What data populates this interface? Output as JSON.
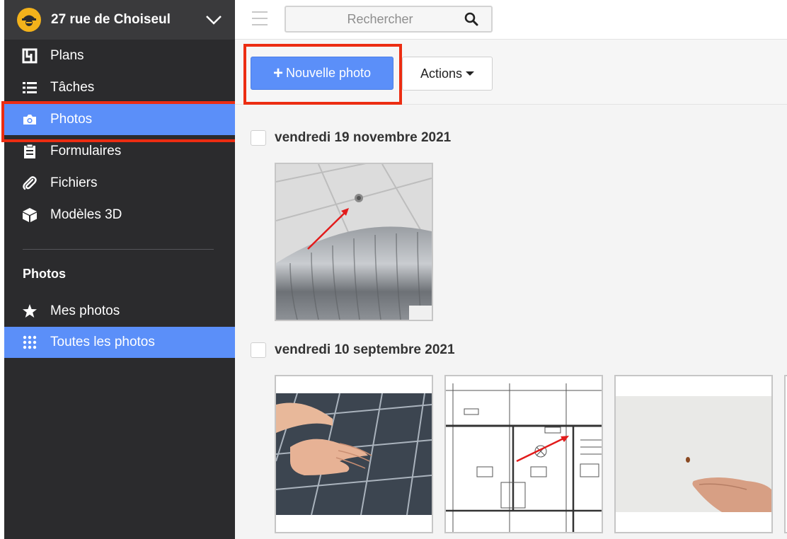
{
  "project": {
    "name": "27 rue de Choiseul",
    "logo_icon": "construction-worker-icon",
    "chevron_icon": "chevron-down-icon"
  },
  "nav": {
    "items": [
      {
        "label": "Plans",
        "icon": "plans-icon"
      },
      {
        "label": "Tâches",
        "icon": "list-icon"
      },
      {
        "label": "Photos",
        "icon": "camera-icon",
        "active": true
      },
      {
        "label": "Formulaires",
        "icon": "clipboard-icon"
      },
      {
        "label": "Fichiers",
        "icon": "paperclip-icon"
      },
      {
        "label": "Modèles 3D",
        "icon": "cube-icon"
      }
    ]
  },
  "photos_section": {
    "title": "Photos",
    "items": [
      {
        "label": "Mes photos",
        "icon": "star-icon"
      },
      {
        "label": "Toutes les photos",
        "icon": "grid-icon",
        "active": true
      }
    ]
  },
  "search": {
    "placeholder": "Rechercher",
    "icon": "search-icon"
  },
  "toolbar": {
    "new_photo_label": "Nouvelle photo",
    "actions_label": "Actions"
  },
  "groups": [
    {
      "date": "vendredi 19 novembre 2021",
      "photos": [
        "ceiling-duct-photo"
      ]
    },
    {
      "date": "vendredi 10 septembre 2021",
      "photos": [
        "solar-panel-photo",
        "floor-plan-photo",
        "wall-hole-photo"
      ]
    }
  ],
  "colors": {
    "accent": "#5b8ff9",
    "sidebar_bg": "#2b2b2d",
    "highlight": "#ec2d12"
  }
}
